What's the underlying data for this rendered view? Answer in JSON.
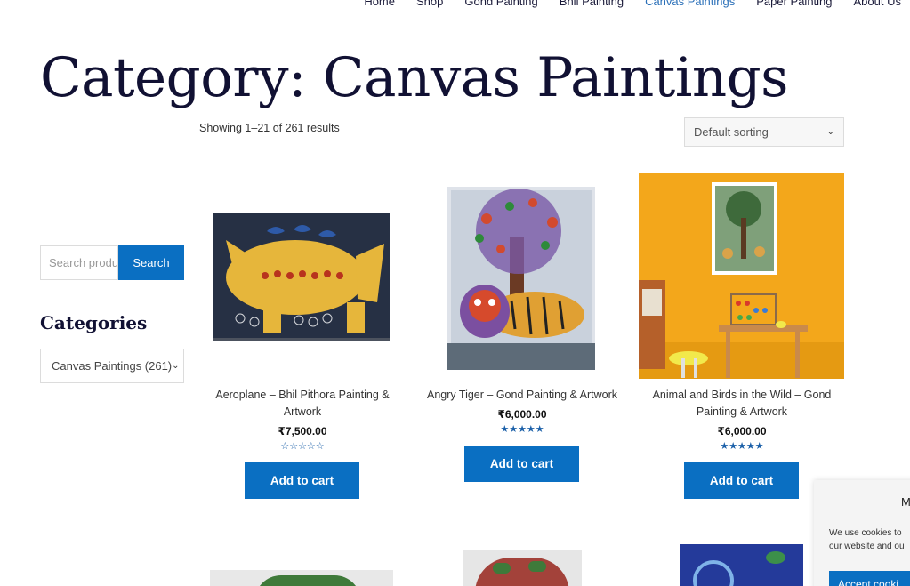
{
  "nav": {
    "items": [
      "Home",
      "Shop",
      "Gond Painting",
      "Bhil Painting",
      "Canvas Paintings",
      "Paper Painting",
      "About Us"
    ],
    "active_index": 4,
    "accent_color": "#2a6fb8"
  },
  "page": {
    "title": "Category: Canvas Paintings",
    "result_count": "Showing 1–21 of 261 results",
    "sort_selected": "Default sorting"
  },
  "sidebar": {
    "search_placeholder": "Search products…",
    "search_button": "Search",
    "categories_heading": "Categories",
    "category_selected": "Canvas Paintings  (261)"
  },
  "products": [
    {
      "name": "Aeroplane – Bhil Pithora Painting & Artwork",
      "price": "₹7,500.00",
      "rating": 0,
      "add_to_cart": "Add to cart"
    },
    {
      "name": "Angry Tiger – Gond Painting & Artwork",
      "price": "₹6,000.00",
      "rating": 5,
      "add_to_cart": "Add to cart"
    },
    {
      "name": "Animal and Birds in the Wild – Gond Painting & Artwork",
      "price": "₹6,000.00",
      "rating": 5,
      "add_to_cart": "Add to cart"
    }
  ],
  "cookie": {
    "title": "M",
    "text_line1": "We use cookies to",
    "text_line2": "our website and ou",
    "accept_label": "Accept cooki"
  },
  "colors": {
    "button": "#0a6fc2",
    "star": "#1a5fa8",
    "title": "#111133"
  }
}
